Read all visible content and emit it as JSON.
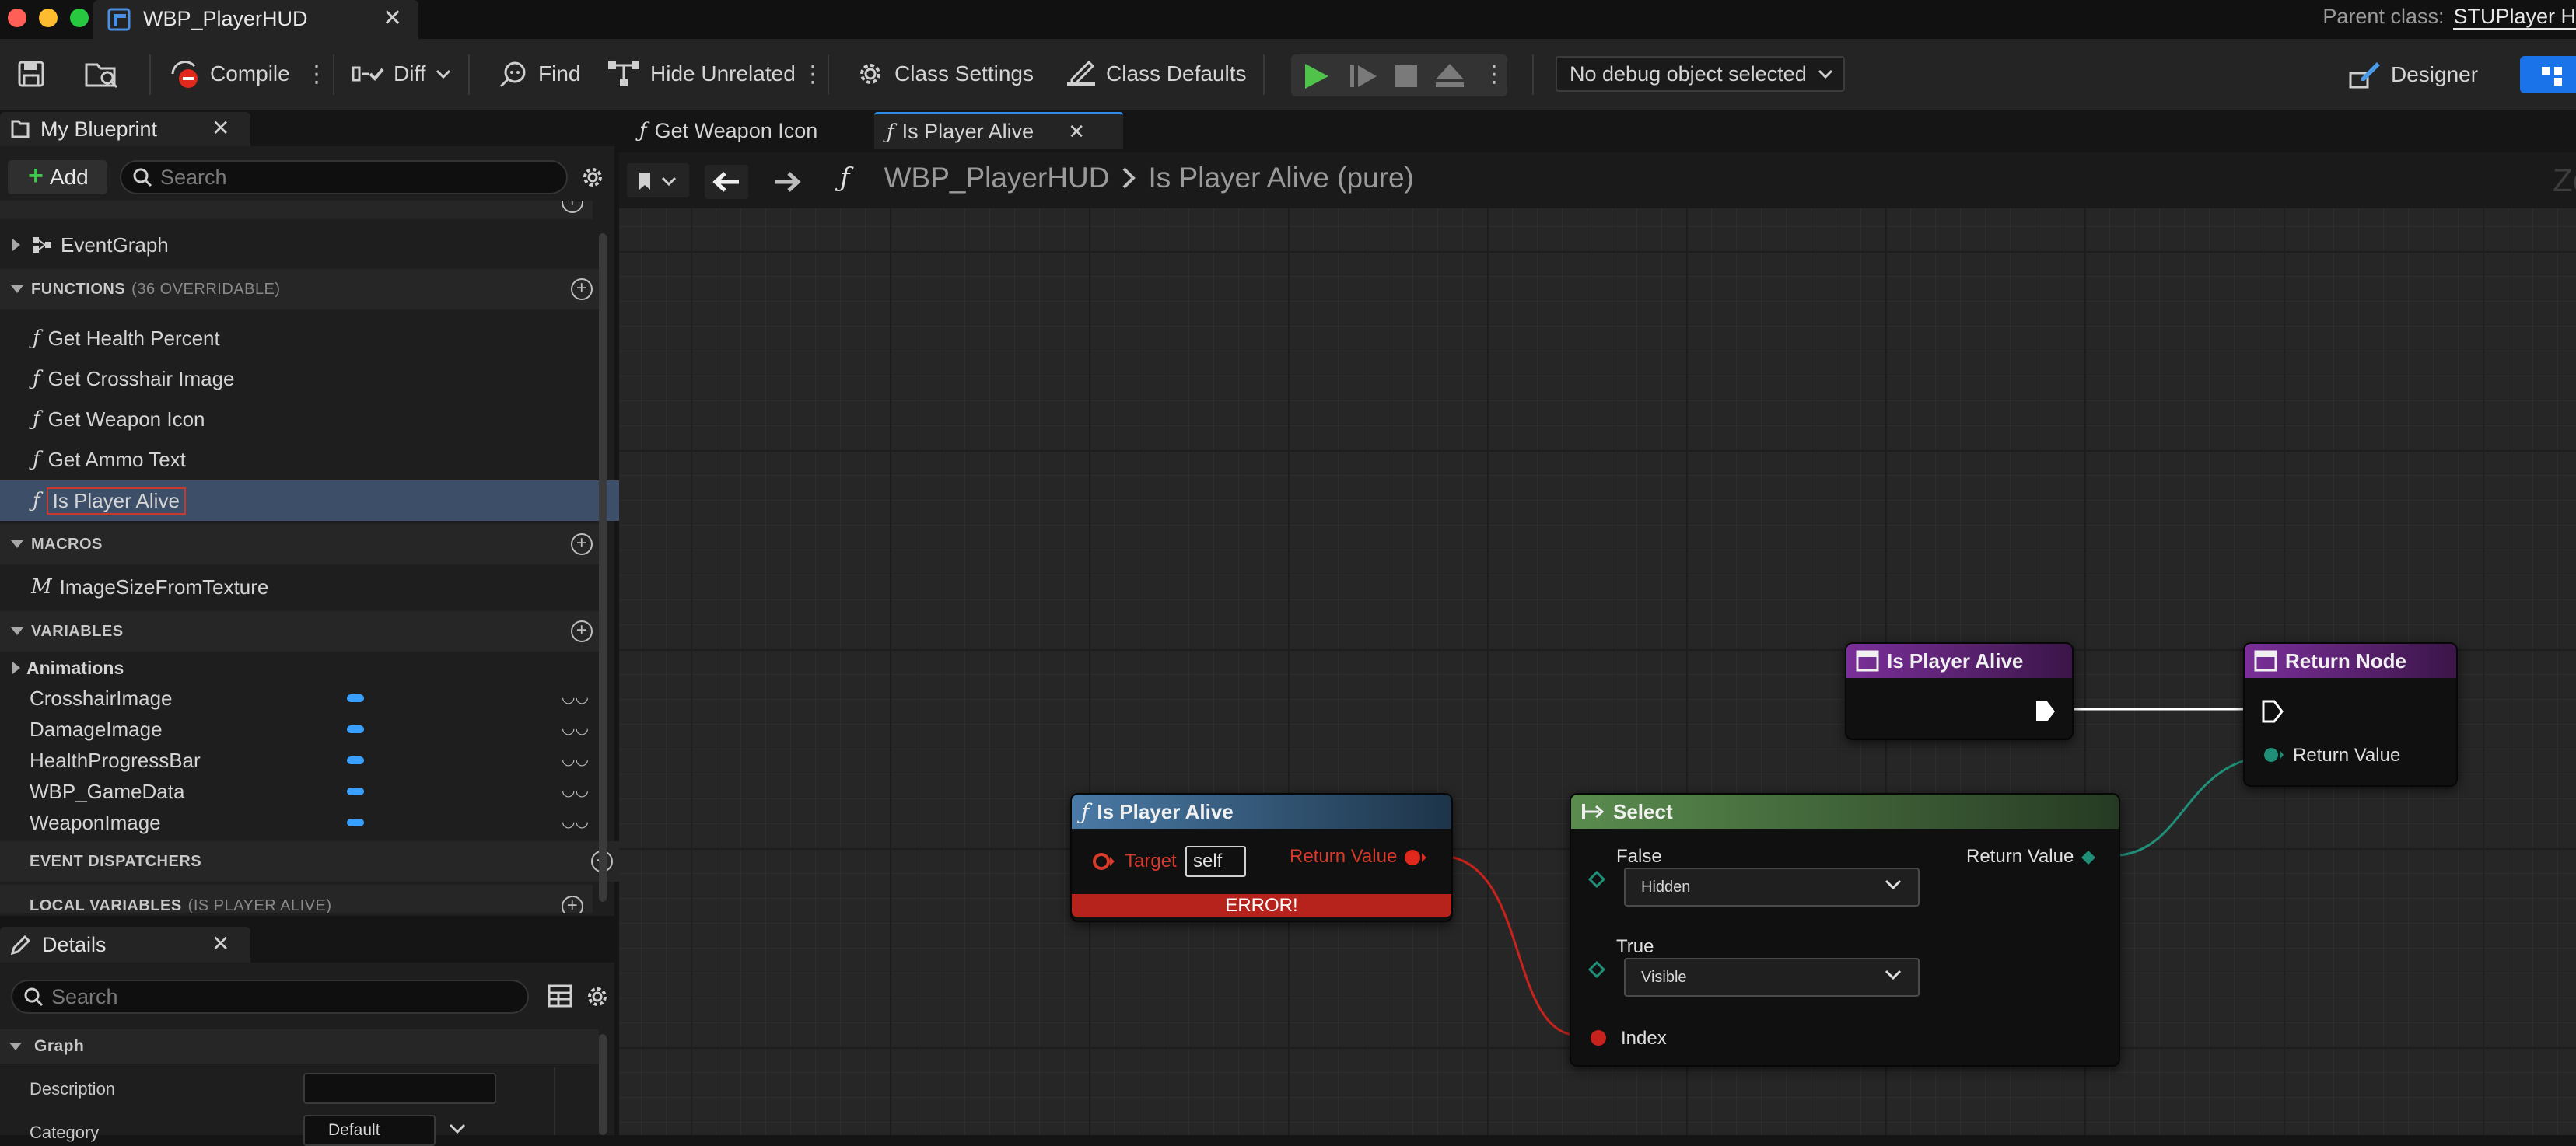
{
  "window": {
    "doc_tab_title": "WBP_PlayerHUD",
    "parent_class_label": "Parent class:",
    "parent_class_value": "STUPlayer H"
  },
  "toolbar": {
    "compile": "Compile",
    "diff": "Diff",
    "find": "Find",
    "hide_unrelated": "Hide Unrelated",
    "class_settings": "Class Settings",
    "class_defaults": "Class Defaults",
    "debug_object": "No debug object selected",
    "designer": "Designer"
  },
  "my_blueprint": {
    "tab_title": "My Blueprint",
    "add_label": "Add",
    "search_placeholder": "Search",
    "event_graph": "EventGraph",
    "functions_header": "FUNCTIONS",
    "functions_sub": "(36 OVERRIDABLE)",
    "functions": [
      "Get Health Percent",
      "Get Crosshair Image",
      "Get Weapon Icon",
      "Get Ammo Text",
      "Is Player Alive"
    ],
    "macros_header": "MACROS",
    "macros": [
      "ImageSizeFromTexture"
    ],
    "variables_header": "VARIABLES",
    "variable_group": "Animations",
    "variables": [
      "CrosshairImage",
      "DamageImage",
      "HealthProgressBar",
      "WBP_GameData",
      "WeaponImage"
    ],
    "event_dispatchers_header": "EVENT DISPATCHERS",
    "local_variables_header": "LOCAL VARIABLES",
    "local_variables_sub": "(IS PLAYER ALIVE)"
  },
  "details": {
    "tab_title": "Details",
    "search_placeholder": "Search",
    "section": "Graph",
    "description_label": "Description",
    "category_label": "Category",
    "category_value": "Default"
  },
  "graph_tabs": [
    "Get Weapon Icon",
    "Is Player Alive"
  ],
  "breadcrumb": {
    "root": "WBP_PlayerHUD",
    "current": "Is Player Alive (pure)",
    "zoom_partial": "Zo"
  },
  "nodes": {
    "entry": {
      "title": "Is Player Alive"
    },
    "return": {
      "title": "Return Node",
      "pin": "Return Value"
    },
    "call": {
      "title": "Is Player Alive",
      "target_label": "Target",
      "target_value": "self",
      "return_label": "Return Value",
      "error": "ERROR!"
    },
    "select": {
      "title": "Select",
      "false_label": "False",
      "false_value": "Hidden",
      "true_label": "True",
      "true_value": "Visible",
      "index_label": "Index",
      "return_label": "Return Value"
    }
  },
  "colors": {
    "accent_blue": "#1a73e8",
    "selection": "#3d4f68",
    "error_red": "#b5231c",
    "node_function_header": "#3f6a8e",
    "node_entry_header": "#6a2f86",
    "node_select_header": "#4f7a45",
    "pin_bool": "#c7231c",
    "pin_enum": "#1f8f78",
    "variable_pill": "#3aa0ff"
  }
}
